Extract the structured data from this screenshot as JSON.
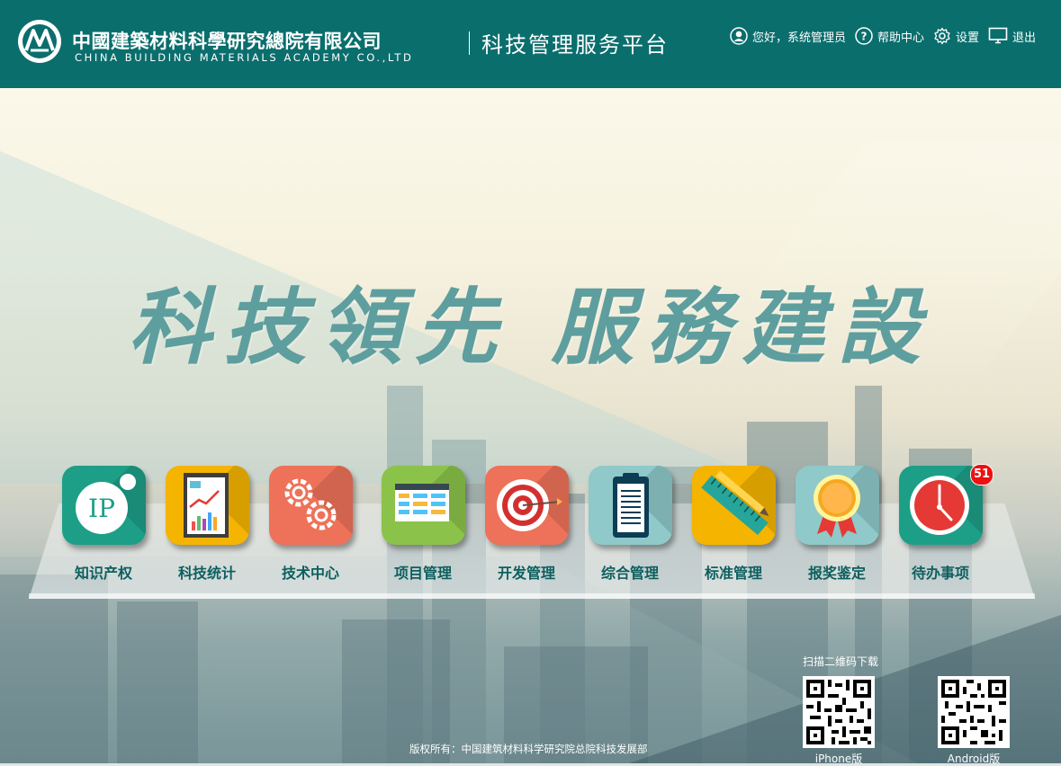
{
  "header": {
    "org_name_cn": "中國建築材料科學研究總院有限公司",
    "org_name_en": "CHINA BUILDING MATERIALS ACADEMY CO.,LTD",
    "platform_title": "科技管理服务平台",
    "user_greeting": "您好，系统管理员",
    "help_label": "帮助中心",
    "settings_label": "设置",
    "logout_label": "退出",
    "colors": {
      "header_bg": "#0a6e6d"
    }
  },
  "hero": {
    "slogan": "科技領先 服務建設"
  },
  "apps": [
    {
      "label": "知识产权",
      "icon": "ip-icon",
      "color": "#1d9f87"
    },
    {
      "label": "科技统计",
      "icon": "chart-report-icon",
      "color": "#f5b400"
    },
    {
      "label": "技术中心",
      "icon": "gears-icon",
      "color": "#ee7259"
    },
    {
      "label": "项目管理",
      "icon": "project-board-icon",
      "color": "#8bc34a"
    },
    {
      "label": "开发管理",
      "icon": "target-icon",
      "color": "#ee7259"
    },
    {
      "label": "综合管理",
      "icon": "clipboard-icon",
      "color": "#8fc9c9"
    },
    {
      "label": "标准管理",
      "icon": "ruler-pencil-icon",
      "color": "#f5b400"
    },
    {
      "label": "报奖鉴定",
      "icon": "award-medal-icon",
      "color": "#8fc9c9"
    },
    {
      "label": "待办事项",
      "icon": "clock-icon",
      "color": "#1d9f87",
      "badge": "51"
    }
  ],
  "download": {
    "title": "扫描二维码下载",
    "iphone_label": "iPhone版",
    "android_label": "Android版"
  },
  "footer": {
    "copyright": "版权所有：中国建筑材料科学研究院总院科技发展部"
  }
}
